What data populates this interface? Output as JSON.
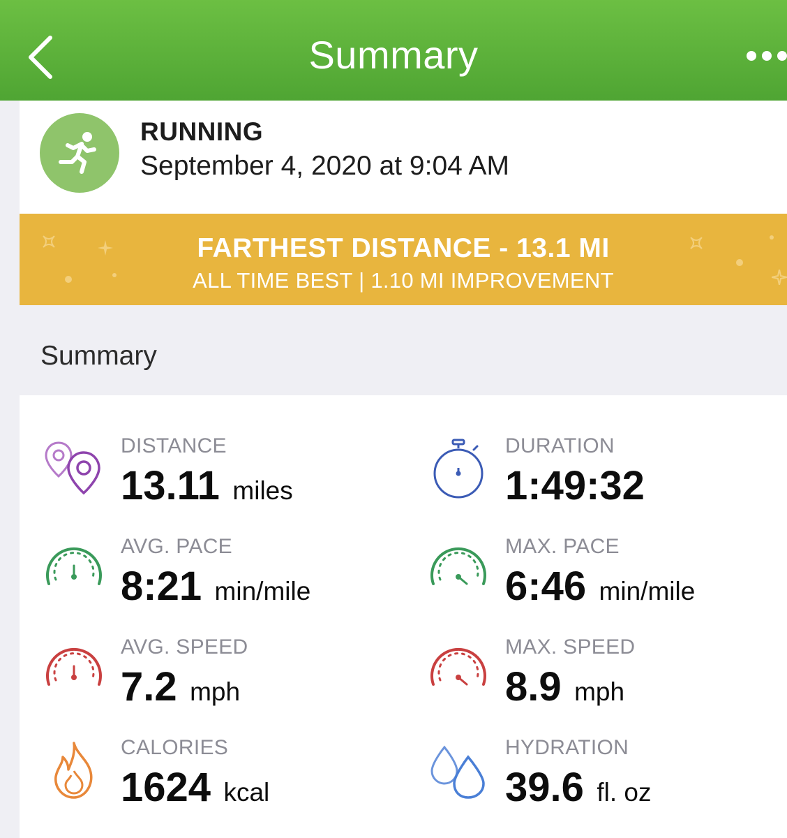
{
  "nav": {
    "title": "Summary"
  },
  "activity": {
    "type": "RUNNING",
    "date": "September 4, 2020 at 9:04 AM"
  },
  "banner": {
    "title": "FARTHEST DISTANCE - 13.1 MI",
    "subtitle": "ALL TIME BEST  |  1.10 MI IMPROVEMENT",
    "color": "#e8b53e"
  },
  "section": {
    "title": "Summary"
  },
  "stats": {
    "distance": {
      "label": "DISTANCE",
      "value": "13.11",
      "unit": "miles",
      "icon": "location-pins-icon",
      "color": "#8e44ad"
    },
    "duration": {
      "label": "DURATION",
      "value": "1:49:32",
      "unit": "",
      "icon": "stopwatch-icon",
      "color": "#3b5bb5"
    },
    "avg_pace": {
      "label": "AVG. PACE",
      "value": "8:21",
      "unit": "min/mile",
      "icon": "gauge-icon",
      "color": "#3a9a5a"
    },
    "max_pace": {
      "label": "MAX. PACE",
      "value": "6:46",
      "unit": "min/mile",
      "icon": "gauge-icon",
      "color": "#3a9a5a"
    },
    "avg_speed": {
      "label": "AVG. SPEED",
      "value": "7.2",
      "unit": "mph",
      "icon": "speedometer-icon",
      "color": "#c94040"
    },
    "max_speed": {
      "label": "MAX. SPEED",
      "value": "8.9",
      "unit": "mph",
      "icon": "speedometer-icon",
      "color": "#c94040"
    },
    "calories": {
      "label": "CALORIES",
      "value": "1624",
      "unit": "kcal",
      "icon": "flame-icon",
      "color": "#e8883a"
    },
    "hydration": {
      "label": "HYDRATION",
      "value": "39.6",
      "unit": "fl. oz",
      "icon": "water-drops-icon",
      "color": "#4a7fd6"
    }
  },
  "theme": {
    "nav_green": "#5cb33b",
    "avatar_green": "#8fc46b"
  }
}
